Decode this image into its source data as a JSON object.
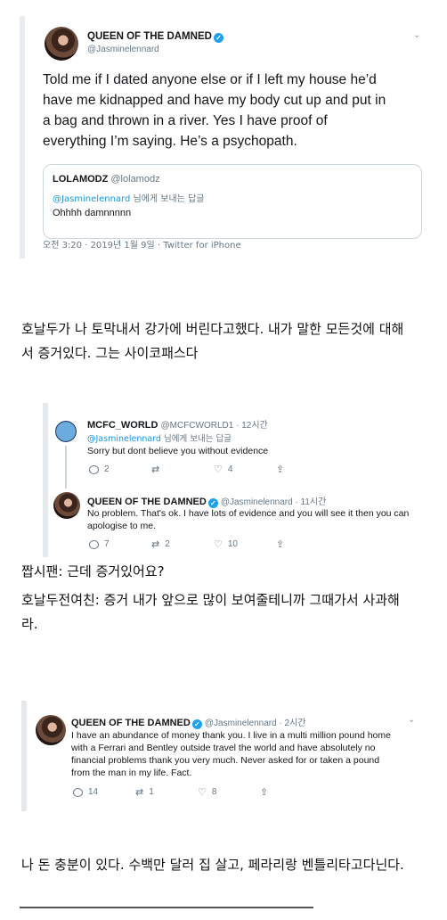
{
  "tweet1": {
    "name": "QUEEN OF THE DAMNED",
    "handle": "@Jasminelennard",
    "text_lines": [
      "Told me if I dated anyone else or if I left my house he’d",
      "have me kidnapped and have my body cut up and put in",
      "a bag and thrown in a river. Yes I have proof of",
      "everything I’m saying. He’s a psychopath."
    ],
    "quote": {
      "name": "LOLAMODZ",
      "handle": "@lolamodz",
      "reply_to_handle": "@Jasminelennard",
      "reply_to_suffix": " 님에게 보내는 답글",
      "text": "Ohhhh damnnnnn"
    },
    "timestamp": "오전 3:20 · 2019년 1월 9일 · Twitter for iPhone"
  },
  "caption1": [
    "호날두가 나 토막내서 강가에 버린다고했다. 내가 말한 모든것에 대해",
    "서 증거있다. 그는 사이코패스다"
  ],
  "thread": {
    "reply1": {
      "name": "MCFC_WORLD",
      "handle_time": "@MCFCWORLD1 · 12시간",
      "reply_to_handle": "@Jasminelennard",
      "reply_to_suffix": " 님에게 보내는 답글",
      "text": "Sorry but dont believe you without evidence",
      "replies": "2",
      "retweets": "",
      "likes": "4"
    },
    "reply2": {
      "name": "QUEEN OF THE DAMNED",
      "handle_time": "@Jasminelennard · 11시간",
      "text_lines": [
        "No problem. That's ok. I have lots of evidence and you will see it then you can",
        "apologise to me."
      ],
      "replies": "7",
      "retweets": "2",
      "likes": "10"
    }
  },
  "caption2": {
    "line1": "짭시팬: 근데 증거있어요?",
    "line2": "호날두전여친: 증거 내가 앞으로 많이 보여줄테니까 그때가서 사과해",
    "line3": "라."
  },
  "tweet3": {
    "name": "QUEEN OF THE DAMNED",
    "handle_time": "@Jasminelennard · 2시간",
    "text_lines": [
      "I have an abundance of money thank you. I live in a multi million pound home",
      "with a Ferrari and Bentley outside travel the world and have absolutely no",
      "financial problems thank you very much. Never asked for or taken a pound",
      "from the man in my life. Fact."
    ],
    "replies": "14",
    "retweets": "1",
    "likes": "8"
  },
  "caption3": "나 돈 충분이 있다. 수백만 달러 집 살고, 페라리랑 벤틀리타고다닌다.",
  "icons": {
    "verified": "verified-badge-icon",
    "reply": "reply-icon",
    "retweet": "retweet-icon",
    "like": "heart-icon",
    "share": "share-icon",
    "more": "chevron-down-icon"
  },
  "colors": {
    "link": "#1b95e0",
    "verified": "#1da1f2",
    "muted": "#657786"
  }
}
